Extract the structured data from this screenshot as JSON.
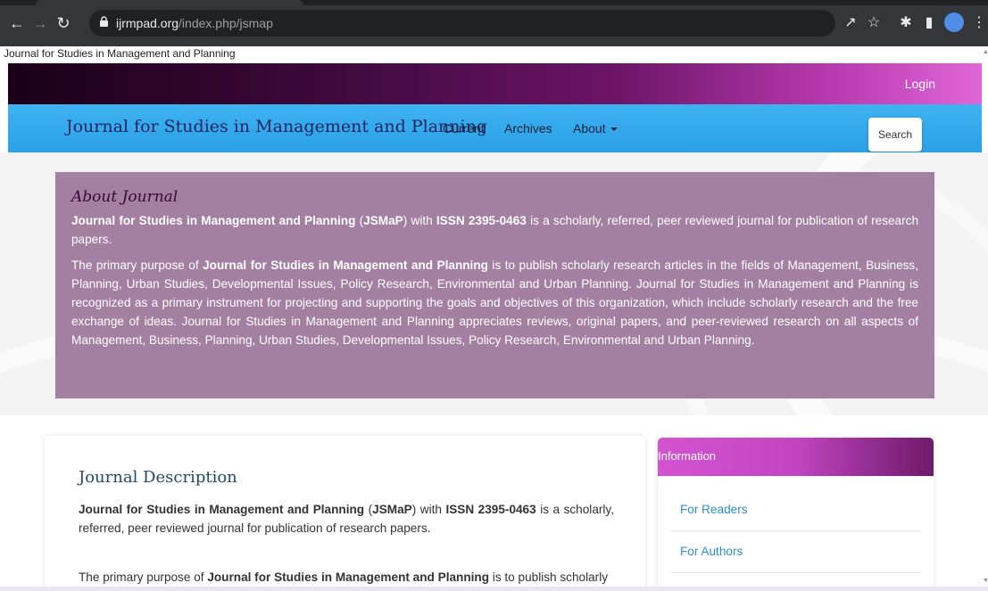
{
  "browser": {
    "url_domain": "ijrmpad.org",
    "url_path": "/index.php/jsmap",
    "tooltip": "Journal for Studies in Management and Planning"
  },
  "header": {
    "login": "Login",
    "brand": "Journal for Studies in Management and Planning",
    "nav": {
      "current": "Current",
      "archives": "Archives",
      "about": "About"
    },
    "search": "Search"
  },
  "about": {
    "title": "About Journal",
    "p1": {
      "journal_name": "Journal for Studies in Management and Planning",
      "abbr": "JSMaP",
      "t1": " (",
      "t2": ") with ",
      "issn": "ISSN 2395-0463",
      "t3": " is a scholarly, referred, peer reviewed journal for publication of research papers."
    },
    "p2": {
      "t1": "The primary purpose of ",
      "journal_name": "Journal for Studies in Management and Planning",
      "t2": " is to publish scholarly research articles in the fields of Management, Business, Planning, Urban Studies, Developmental Issues, Policy Research, Environmental and Urban Planning. Journal for Studies in Management and Planning is recognized as a primary instrument for projecting and supporting the goals and objectives of this organization, which include scholarly research and the free exchange of ideas. Journal for Studies in Management and Planning appreciates reviews, original papers, and peer-reviewed research on all aspects of Management, Business, Planning, Urban Studies, Developmental Issues, Policy Research, Environmental and Urban Planning."
    }
  },
  "description": {
    "title": "Journal Description",
    "p1": {
      "journal_name": "Journal for Studies in Management and Planning",
      "abbr": "JSMaP",
      "t1": " (",
      "t2": ") with ",
      "issn": "ISSN 2395-0463",
      "t3": " is a scholarly, referred, peer reviewed journal for publication of research papers."
    },
    "p2": {
      "t1": "The primary purpose of ",
      "journal_name": "Journal for Studies in Management and Planning",
      "t2": " is to publish scholarly"
    }
  },
  "sidebar": {
    "heading": "Information",
    "links": [
      "For Readers",
      "For Authors"
    ]
  },
  "colors": {
    "navbar": "#2aa0e8",
    "about_box": "#a37fa2",
    "info_head": "#d453d0",
    "link": "#2a8fd0"
  }
}
